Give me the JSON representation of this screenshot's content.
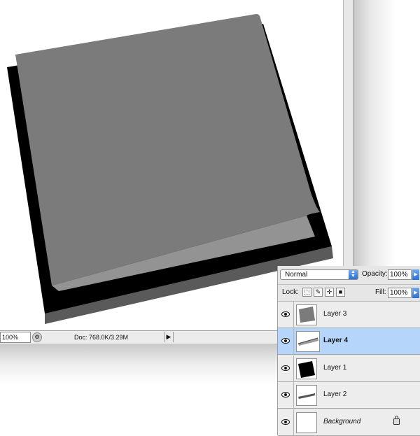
{
  "status_bar": {
    "zoom": "100%",
    "doc_info": "Doc: 768.0K/3.29M",
    "menu_arrow": "▶"
  },
  "layers_panel": {
    "blend_mode": "Normal",
    "opacity_label": "Opacity:",
    "opacity_value": "100%",
    "lock_label": "Lock:",
    "fill_label": "Fill:",
    "fill_value": "100%",
    "layers": [
      {
        "name": "Layer 3",
        "visible": true,
        "selected": false
      },
      {
        "name": "Layer 4",
        "visible": true,
        "selected": true
      },
      {
        "name": "Layer 1",
        "visible": true,
        "selected": false
      },
      {
        "name": "Layer 2",
        "visible": true,
        "selected": false
      },
      {
        "name": "Background",
        "visible": true,
        "selected": false,
        "locked": true
      }
    ]
  },
  "colors": {
    "paper_gray": "#7b7b7b",
    "paper_curl": "#929292",
    "base_black": "#000000",
    "base_edge": "#595959",
    "selection_blue": "#b6d5fb"
  }
}
